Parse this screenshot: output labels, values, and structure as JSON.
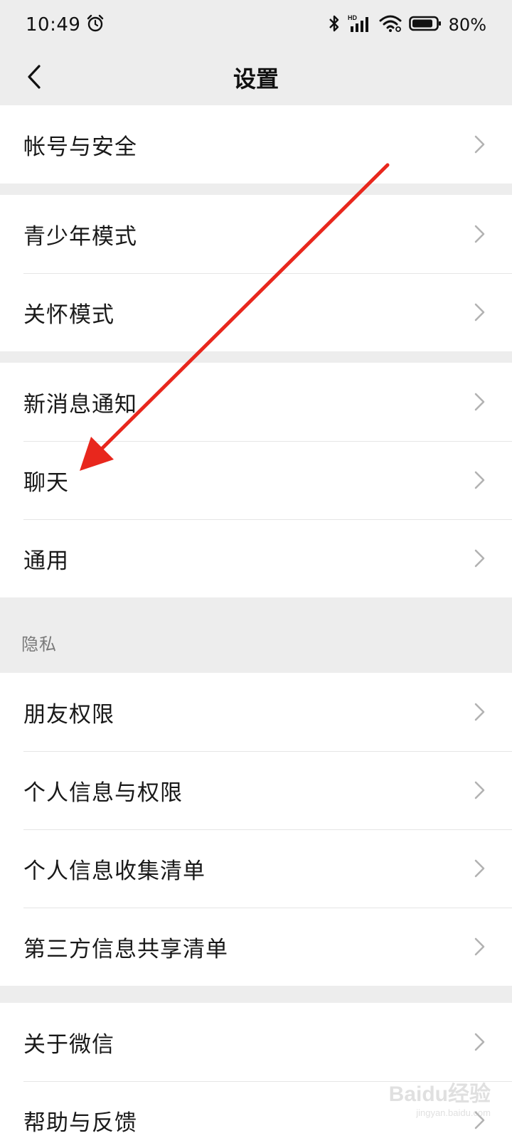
{
  "status_bar": {
    "time": "10:49",
    "battery_percent": "80%",
    "icons": [
      "alarm-icon",
      "bluetooth-icon",
      "signal-icon",
      "wifi-icon",
      "battery-icon"
    ],
    "signal_hd_label": "HD"
  },
  "nav": {
    "title": "设置",
    "back_icon": "chevron-left-icon"
  },
  "groups": [
    {
      "items": [
        {
          "label": "帐号与安全"
        }
      ]
    },
    {
      "items": [
        {
          "label": "青少年模式"
        },
        {
          "label": "关怀模式"
        }
      ]
    },
    {
      "items": [
        {
          "label": "新消息通知"
        },
        {
          "label": "聊天"
        },
        {
          "label": "通用"
        }
      ]
    },
    {
      "header": "隐私",
      "items": [
        {
          "label": "朋友权限"
        },
        {
          "label": "个人信息与权限"
        },
        {
          "label": "个人信息收集清单"
        },
        {
          "label": "第三方信息共享清单"
        }
      ]
    },
    {
      "items": [
        {
          "label": "关于微信"
        },
        {
          "label": "帮助与反馈"
        }
      ]
    }
  ],
  "annotation": {
    "type": "arrow",
    "color": "#e8271d",
    "points_to": "聊天"
  },
  "watermark": {
    "logo": "Baidu经验",
    "url": "jingyan.baidu.com"
  },
  "colors": {
    "background": "#ededed",
    "card": "#ffffff",
    "divider": "#e5e5e5",
    "chevron": "#b2b2b2",
    "section_header_text": "#7a7a7a"
  }
}
